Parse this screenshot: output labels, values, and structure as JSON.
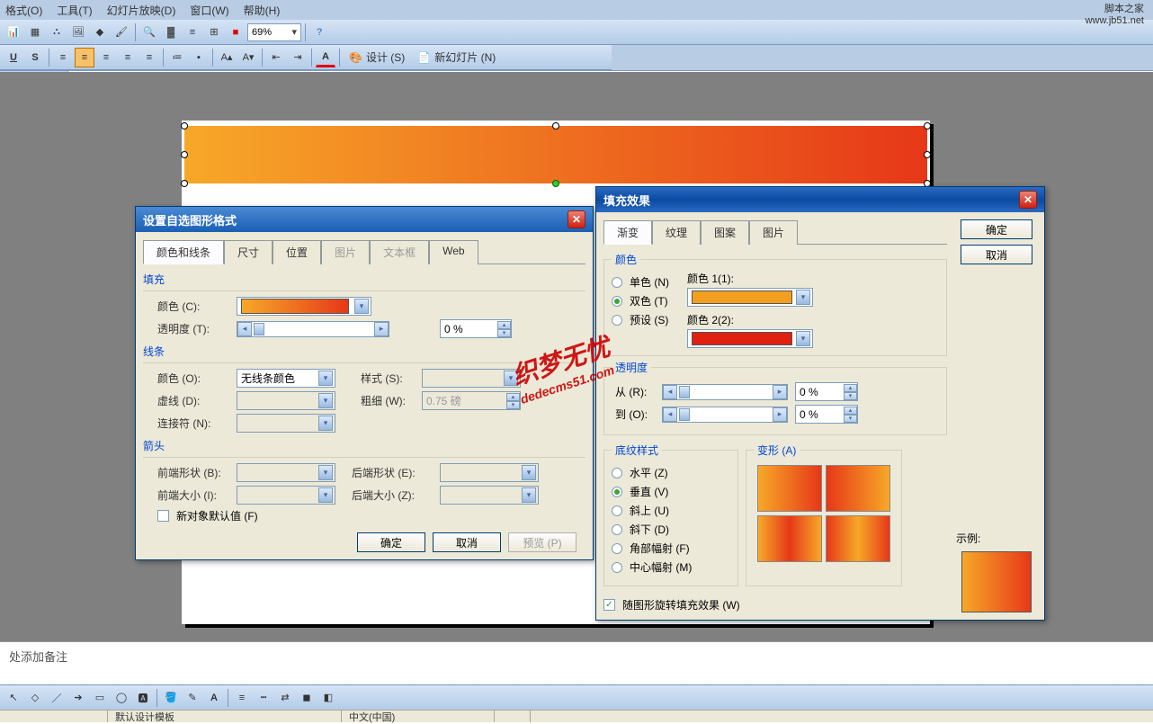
{
  "menubar": [
    "格式(O)",
    "工具(T)",
    "幻灯片放映(D)",
    "窗口(W)",
    "帮助(H)"
  ],
  "zoom_value": "69%",
  "design_label": "设计 (S)",
  "newslide_label": "新幻灯片 (N)",
  "notes_placeholder": "处添加备注",
  "status": {
    "template": "默认设计模板",
    "lang": "中文(中国)"
  },
  "watermark": {
    "l1": "脚本之家",
    "l2": "www.jb51.net"
  },
  "watermark2": {
    "l1": "织梦无忧",
    "l2": "dedecms51.com"
  },
  "dlg1": {
    "title": "设置自选图形格式",
    "tabs": [
      "颜色和线条",
      "尺寸",
      "位置",
      "图片",
      "文本框",
      "Web"
    ],
    "fill_group": "填充",
    "color_label": "颜色 (C):",
    "transparency_label": "透明度 (T):",
    "transparency_value": "0 %",
    "line_group": "线条",
    "line_color_label": "颜色 (O):",
    "line_color_value": "无线条颜色",
    "style_label": "样式 (S):",
    "dash_label": "虚线 (D):",
    "weight_label": "粗细 (W):",
    "weight_value": "0.75 磅",
    "connector_label": "连接符 (N):",
    "arrow_group": "箭头",
    "begin_style": "前端形状 (B):",
    "end_style": "后端形状 (E):",
    "begin_size": "前端大小 (I):",
    "end_size": "后端大小 (Z):",
    "default_check": "新对象默认值 (F)",
    "ok": "确定",
    "cancel": "取消",
    "preview": "预览 (P)"
  },
  "dlg2": {
    "title": "填充效果",
    "tabs": [
      "渐变",
      "纹理",
      "图案",
      "图片"
    ],
    "ok": "确定",
    "cancel": "取消",
    "color_group": "颜色",
    "one_color": "单色 (N)",
    "two_color": "双色 (T)",
    "preset": "预设 (S)",
    "color1_label": "颜色 1(1):",
    "color2_label": "颜色 2(2):",
    "trans_group": "透明度",
    "from_label": "从 (R):",
    "to_label": "到 (O):",
    "from_value": "0 %",
    "to_value": "0 %",
    "style_group": "底纹样式",
    "variant_group": "变形 (A)",
    "horizontal": "水平 (Z)",
    "vertical": "垂直 (V)",
    "diag_up": "斜上 (U)",
    "diag_down": "斜下 (D)",
    "from_corner": "角部幅射 (F)",
    "from_center": "中心幅射 (M)",
    "sample_label": "示例:",
    "rotate_check": "随图形旋转填充效果 (W)"
  }
}
